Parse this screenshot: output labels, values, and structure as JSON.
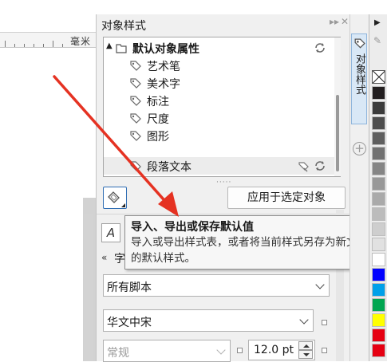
{
  "canvas": {
    "ruler_unit": "毫米"
  },
  "docker": {
    "title": "对象样式",
    "controls": {
      "expand": "▸▸",
      "close": "✕"
    },
    "tree": {
      "root": {
        "label": "默认对象属性",
        "icon": "folder-tag-icon",
        "action_icon": "import-export-icon"
      },
      "items": [
        {
          "label": "艺术笔",
          "icon": "tag-icon"
        },
        {
          "label": "美术字",
          "icon": "tag-icon"
        },
        {
          "label": "标注",
          "icon": "tag-icon"
        },
        {
          "label": "尺度",
          "icon": "tag-icon"
        },
        {
          "label": "图形",
          "icon": "tag-icon"
        },
        {
          "label": "段落文本",
          "icon": "tag-icon",
          "selected": true
        }
      ]
    },
    "grip": "·····",
    "import_export_icon": "import-export-icon",
    "apply_button": "应用于选定对象",
    "char_style_icon": "A",
    "section_collapse_icon": "«",
    "section_label": "字",
    "script_dropdown": "所有脚本",
    "font_dropdown": "华文中宋",
    "style_dropdown": "常规",
    "font_size": "12.0 pt"
  },
  "tooltip": {
    "title": "导入、导出或保存默认值",
    "body": "导入或导出样式表，或者将当前样式另存为新文档的默认样式。"
  },
  "tabs": {
    "object_styles": "对象样式",
    "add": "+"
  },
  "palette": {
    "colors": [
      "#231f20",
      "#3b3b3b",
      "#4d4d4d",
      "#5f5f5f",
      "#727272",
      "#858585",
      "#989898",
      "#aaaaaa",
      "#bcbcbc",
      "#cecece",
      "#e1e1e1",
      "#ffffff",
      "#0000ff",
      "#00a0e9",
      "#00a651",
      "#ffff00",
      "#e60012",
      "#e60012"
    ]
  },
  "annotation": {
    "arrow_color": "#e53222"
  }
}
